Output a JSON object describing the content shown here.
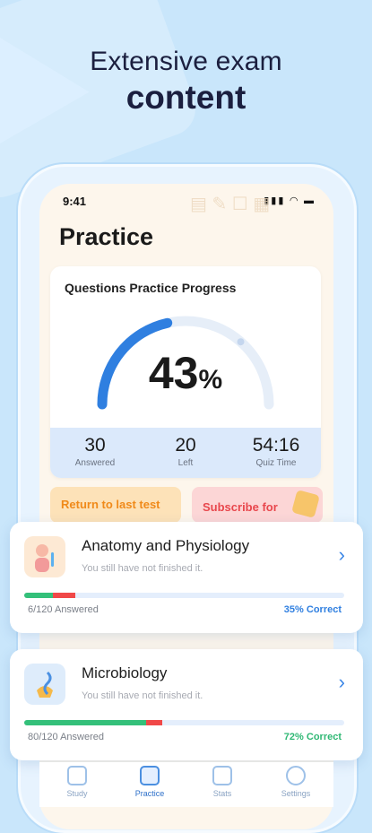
{
  "hero": {
    "line1": "Extensive exam",
    "line2": "content"
  },
  "status_bar": {
    "time": "9:41"
  },
  "page": {
    "title": "Practice"
  },
  "progress": {
    "title": "Questions Practice Progress",
    "percent_value": "43",
    "percent_sign": "%",
    "fraction": 0.43,
    "stats": [
      {
        "value": "30",
        "label": "Answered"
      },
      {
        "value": "20",
        "label": "Left"
      },
      {
        "value": "54:16",
        "label": "Quiz Time"
      }
    ]
  },
  "actions": {
    "return_label": "Return to last test",
    "subscribe_label": "Subscribe for"
  },
  "courses": [
    {
      "name": "Anatomy and Physiology",
      "subtitle": "You still have not finished it.",
      "answered": "6/120 Answered",
      "correct": "35% Correct",
      "correct_color": "#2f7fe0",
      "green_fraction": 0.09,
      "red_fraction": 0.07
    },
    {
      "name": "Microbiology",
      "subtitle": "You still have not finished it.",
      "answered": "80/120 Answered",
      "correct": "72% Correct",
      "correct_color": "#2fb874",
      "green_fraction": 0.38,
      "red_fraction": 0.05
    }
  ],
  "tabs": [
    {
      "label": "Study",
      "icon": "book-icon"
    },
    {
      "label": "Practice",
      "icon": "practice-icon"
    },
    {
      "label": "Stats",
      "icon": "chart-icon"
    },
    {
      "label": "Settings",
      "icon": "gear-icon"
    }
  ],
  "colors": {
    "accent": "#2f7fe0",
    "gauge_track": "#e6eef8"
  }
}
